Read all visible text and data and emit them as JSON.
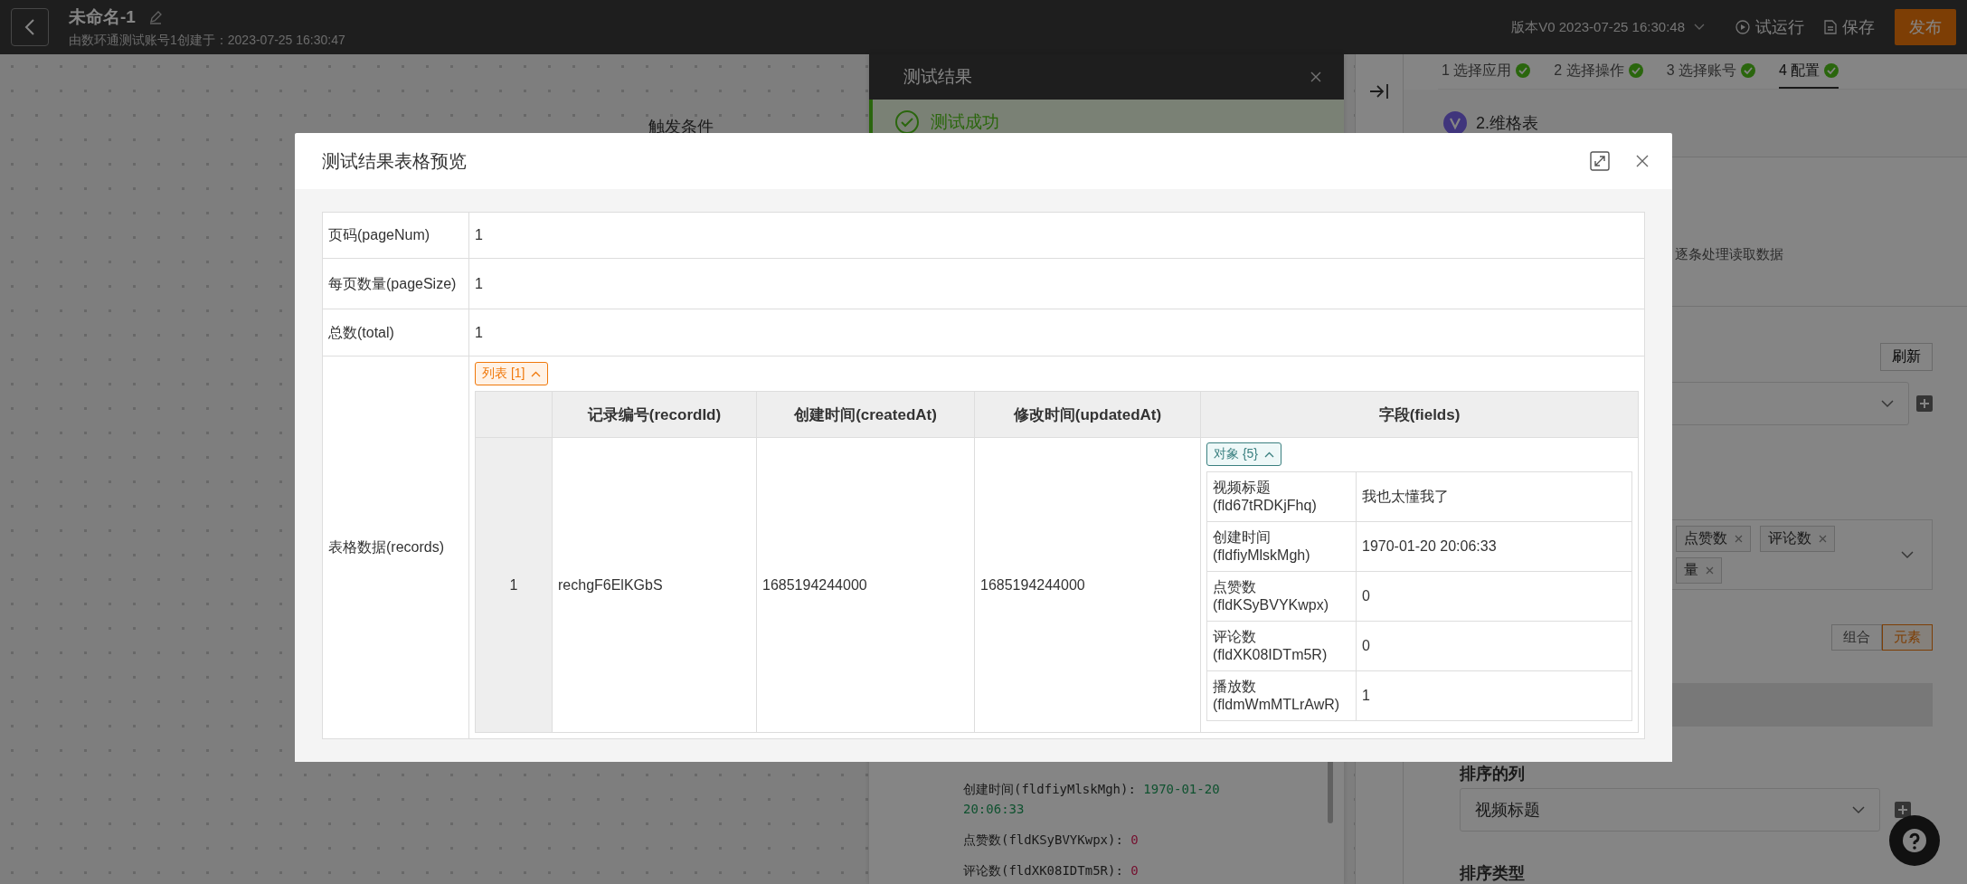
{
  "top_bar": {
    "title": "未命名-1",
    "subtitle": "由数环通测试账号1创建于：2023-07-25 16:30:47",
    "version": "版本V0 2023-07-25 16:30:48",
    "buttons": [
      {
        "label": "试运行",
        "kind": "run"
      },
      {
        "label": "保存",
        "kind": "save"
      },
      {
        "label": "发布",
        "kind": "publish"
      }
    ]
  },
  "canvas": {
    "node_label": "触发条件"
  },
  "test_panel": {
    "title": "测试结果",
    "status": "测试成功",
    "lines": [
      {
        "key": "创建时间(fldfiyMlskMgh):",
        "value": "1970-01-20 20:06:33",
        "kind": "string"
      },
      {
        "key": "点赞数(fldKSyBVYKwpx):",
        "value": "0",
        "kind": "number"
      },
      {
        "key": "评论数(fldXK08IDTm5R):",
        "value": "0",
        "kind": "number"
      }
    ]
  },
  "right_panel": {
    "steps": [
      {
        "label": "1 选择应用",
        "done": true,
        "selected": false
      },
      {
        "label": "2 选择操作",
        "done": true,
        "selected": false
      },
      {
        "label": "3 选择账号",
        "done": true,
        "selected": false
      },
      {
        "label": "4 配置",
        "done": true,
        "selected": true
      }
    ],
    "app_name": "2.维格表",
    "hint": "逐条处理读取数据",
    "refresh": "刷新",
    "tags": [
      "点赞数",
      "评论数",
      "量"
    ],
    "toggle": [
      {
        "label": "组合",
        "selected": false
      },
      {
        "label": "元素",
        "selected": true
      }
    ],
    "sort_column_label": "排序的列",
    "sort_column_value": "视频标题",
    "sort_type_label": "排序类型"
  },
  "modal": {
    "title": "测试结果表格预览",
    "rows": [
      {
        "kind": "value",
        "label": "页码(pageNum)",
        "value": "1"
      },
      {
        "kind": "value",
        "label": "每页数量(pageSize)",
        "value": "1"
      },
      {
        "kind": "value",
        "label": "总数(total)",
        "value": "1"
      },
      {
        "kind": "records",
        "label": "表格数据(records)",
        "list_tag": "列表 [1]",
        "expanded": true,
        "columns": [
          "记录编号(recordId)",
          "创建时间(createdAt)",
          "修改时间(updatedAt)",
          "字段(fields)"
        ],
        "records": [
          {
            "index": "1",
            "cells": [
              "rechgF6ElKGbS",
              "1685194244000",
              "1685194244000"
            ],
            "object_tag": "对象 {5}",
            "object_expanded": true,
            "fields": [
              {
                "key": "视频标题(fld67tRDKjFhq)",
                "value": "我也太懂我了"
              },
              {
                "key": "创建时间(fldfiyMlskMgh)",
                "value": "1970-01-20 20:06:33"
              },
              {
                "key": "点赞数(fldKSyBVYKwpx)",
                "value": "0"
              },
              {
                "key": "评论数(fldXK08IDTm5R)",
                "value": "0"
              },
              {
                "key": "播放数(fldmWmMTLrAwR)",
                "value": "1"
              }
            ]
          }
        ]
      }
    ]
  }
}
